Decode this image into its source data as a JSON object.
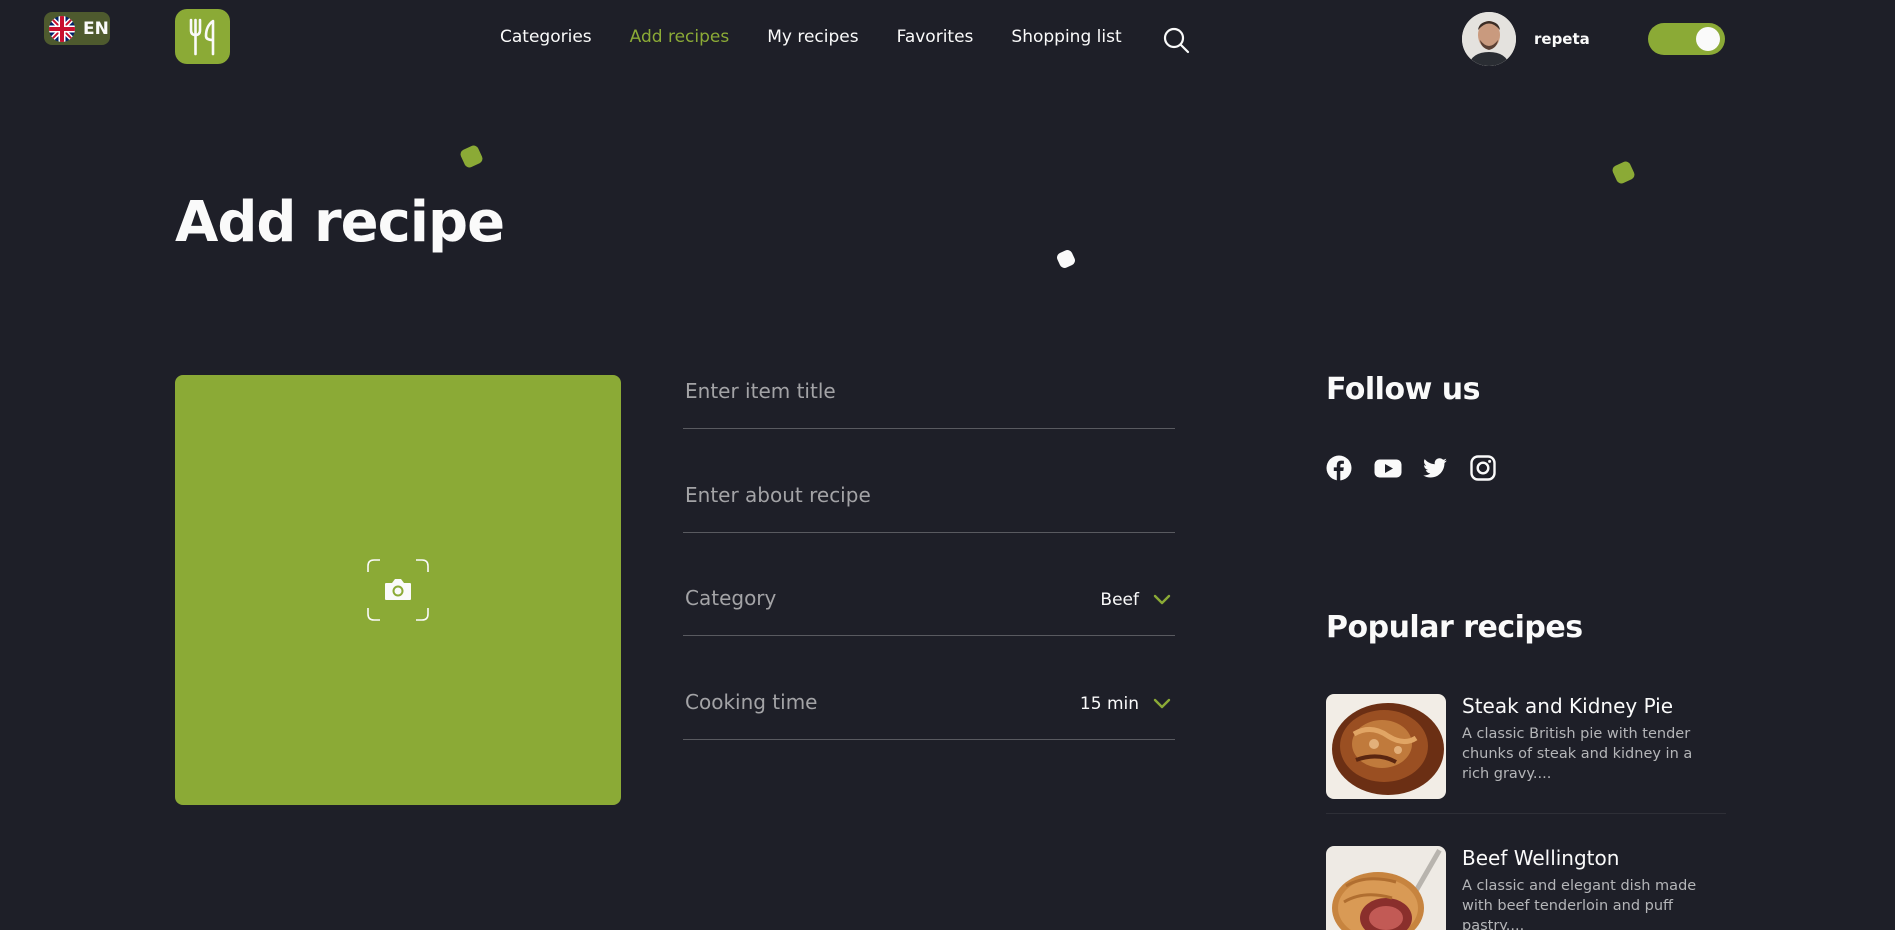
{
  "header": {
    "language": "EN",
    "nav": [
      {
        "label": "Categories"
      },
      {
        "label": "Add recipes"
      },
      {
        "label": "My recipes"
      },
      {
        "label": "Favorites"
      },
      {
        "label": "Shopping list"
      }
    ],
    "active_nav": "Add recipes",
    "username": "repeta",
    "theme_toggle_on": true
  },
  "page": {
    "title": "Add recipe"
  },
  "form": {
    "title_placeholder": "Enter item title",
    "about_placeholder": "Enter about recipe",
    "category_label": "Category",
    "category_value": "Beef",
    "cooking_time_label": "Cooking time",
    "cooking_time_value": "15 min"
  },
  "sidebar": {
    "follow_title": "Follow us",
    "socials": [
      "facebook-icon",
      "youtube-icon",
      "twitter-icon",
      "instagram-icon"
    ],
    "popular_title": "Popular recipes",
    "recipes": [
      {
        "name": "Steak and Kidney Pie",
        "description": "A classic British pie with tender chunks of steak and kidney in a rich gravy...."
      },
      {
        "name": "Beef Wellington",
        "description": "A classic and elegant dish made with beef tenderloin and puff pastry...."
      }
    ]
  },
  "colors": {
    "background": "#1e1f28",
    "accent": "#8baa36",
    "text": "#fafafa",
    "muted": "#a3a3a6"
  }
}
